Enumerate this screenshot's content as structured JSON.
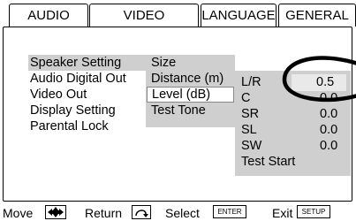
{
  "tabs": [
    "AUDIO",
    "VIDEO",
    "LANGUAGE",
    "GENERAL"
  ],
  "active_tab": "GENERAL",
  "menu": [
    "Speaker Setting",
    "Audio Digital Out",
    "Video Out",
    "Display Setting",
    "Parental Lock"
  ],
  "submenu": [
    "Size",
    "Distance (m)",
    "Level (dB)",
    "Test Tone"
  ],
  "levels": {
    "rows": [
      {
        "label": "L/R",
        "value": "0.5"
      },
      {
        "label": "C",
        "value": "0.0"
      },
      {
        "label": "SR",
        "value": "0.0"
      },
      {
        "label": "SL",
        "value": "0.0"
      },
      {
        "label": "SW",
        "value": "0.0"
      }
    ],
    "test_start": "Test Start"
  },
  "footer": {
    "move": "Move",
    "return": "Return",
    "select": "Select",
    "select_key": "ENTER",
    "exit": "Exit",
    "exit_key": "SETUP"
  }
}
